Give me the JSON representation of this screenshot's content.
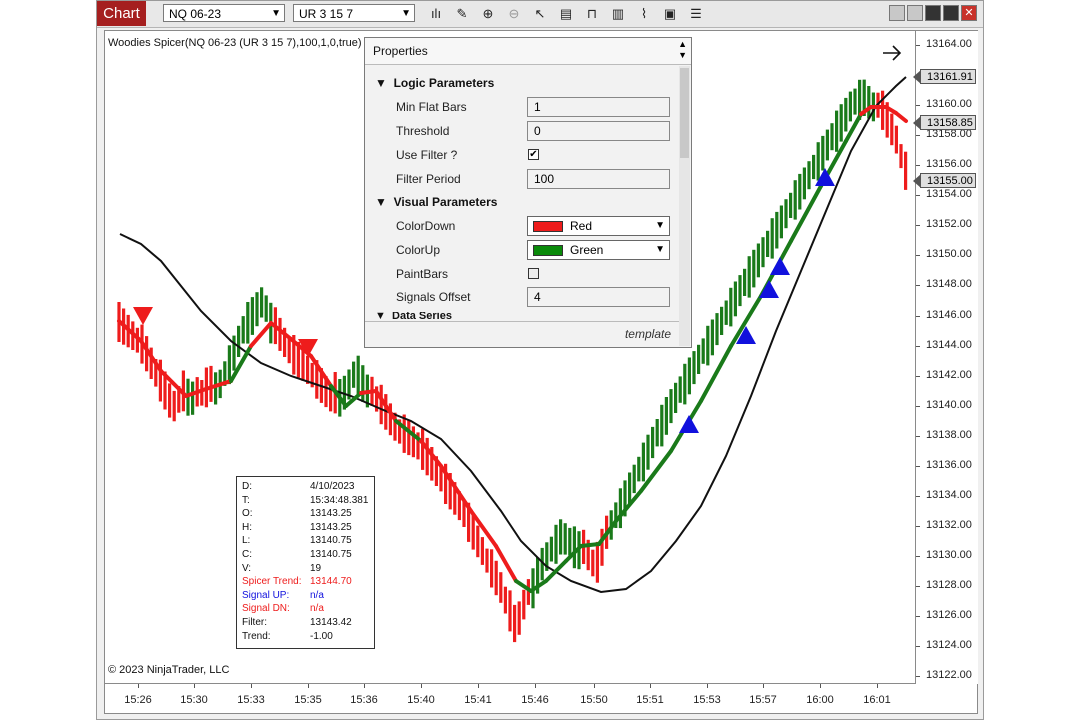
{
  "toolbar": {
    "chart_tab": "Chart",
    "instrument": "NQ 06-23",
    "bar_type": "UR 3 15 7"
  },
  "chart": {
    "indicator_title": "Woodies Spicer(NQ 06-23 (UR 3 15 7),100,1,0,true)",
    "copyright": "© 2023 NinjaTrader, LLC",
    "y_ticks": [
      "13164.00",
      "13162.00",
      "13160.00",
      "13158.00",
      "13156.00",
      "13154.00",
      "13152.00",
      "13150.00",
      "13148.00",
      "13146.00",
      "13144.00",
      "13142.00",
      "13140.00",
      "13138.00",
      "13136.00",
      "13134.00",
      "13132.00",
      "13130.00",
      "13128.00",
      "13126.00",
      "13124.00",
      "13122.00"
    ],
    "price_markers": [
      "13161.91",
      "13158.85",
      "13155.00"
    ],
    "x_ticks": [
      "15:26",
      "15:30",
      "15:33",
      "15:35",
      "15:36",
      "15:40",
      "15:41",
      "15:46",
      "15:50",
      "15:51",
      "15:53",
      "15:57",
      "16:00",
      "16:01"
    ],
    "colors": {
      "up": "#1a7a1a",
      "down": "#ee1c1c",
      "signal_up": "#1111dd",
      "signal_down": "#ee1c1c",
      "filter": "#111111"
    }
  },
  "data_box": {
    "rows": [
      {
        "key": "D:",
        "value": "4/10/2023",
        "color": "#111111"
      },
      {
        "key": "T:",
        "value": "15:34:48.381",
        "color": "#111111"
      },
      {
        "key": "O:",
        "value": "13143.25",
        "color": "#111111"
      },
      {
        "key": "H:",
        "value": "13143.25",
        "color": "#111111"
      },
      {
        "key": "L:",
        "value": "13140.75",
        "color": "#111111"
      },
      {
        "key": "C:",
        "value": "13140.75",
        "color": "#111111"
      },
      {
        "key": "V:",
        "value": "19",
        "color": "#111111"
      },
      {
        "key": "Spicer Trend:",
        "value": "13144.70",
        "color": "#ee1c1c"
      },
      {
        "key": "Signal UP:",
        "value": "n/a",
        "color": "#1111dd"
      },
      {
        "key": "Signal DN:",
        "value": "n/a",
        "color": "#ee1c1c"
      },
      {
        "key": "Filter:",
        "value": "13143.42",
        "color": "#111111"
      },
      {
        "key": "Trend:",
        "value": "-1.00",
        "color": "#111111"
      }
    ]
  },
  "properties": {
    "title": "Properties",
    "logic_section": "Logic Parameters",
    "min_flat_bars_label": "Min Flat Bars",
    "min_flat_bars": "1",
    "threshold_label": "Threshold",
    "threshold": "0",
    "use_filter_label": "Use Filter ?",
    "use_filter": "✔",
    "filter_period_label": "Filter Period",
    "filter_period": "100",
    "visual_section": "Visual Parameters",
    "color_down_label": "ColorDown",
    "color_down": "Red",
    "color_down_swatch": "#ee1c1c",
    "color_up_label": "ColorUp",
    "color_up": "Green",
    "color_up_swatch": "#0a8a0a",
    "paint_bars_label": "PaintBars",
    "signals_offset_label": "Signals Offset",
    "signals_offset": "4",
    "data_series_section": "Data Series",
    "footer": "template"
  }
}
